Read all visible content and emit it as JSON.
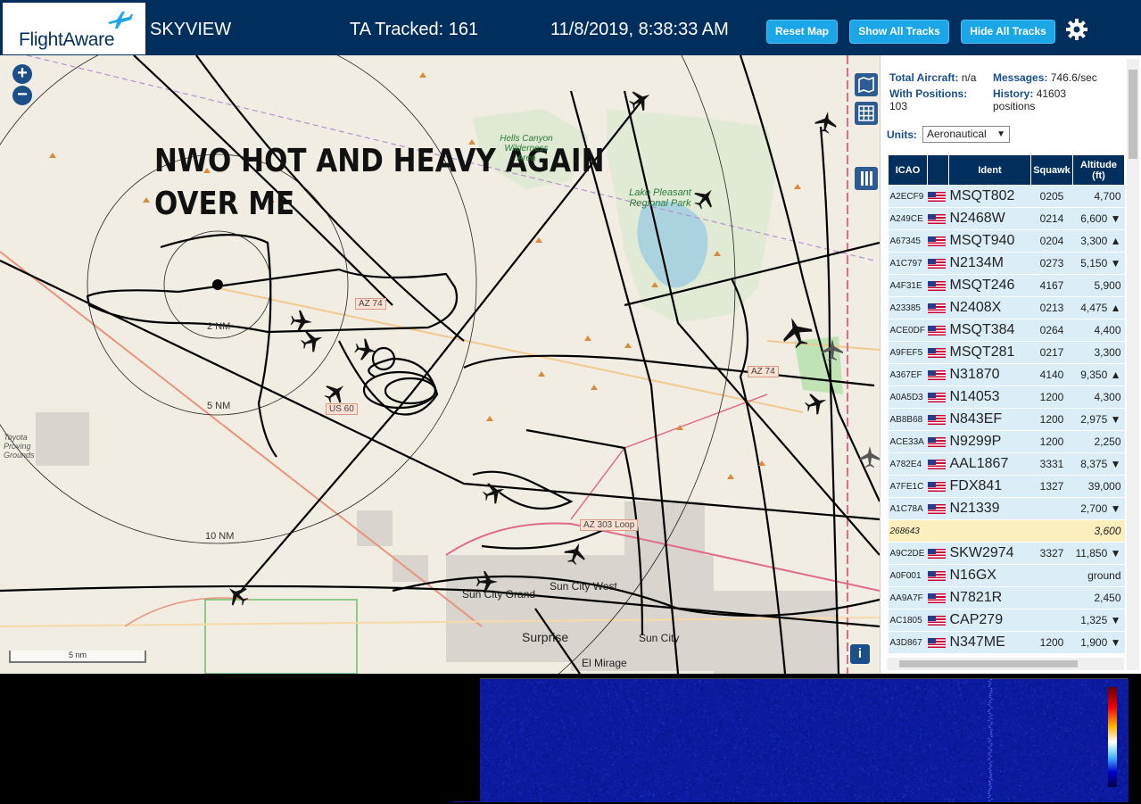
{
  "header": {
    "logo_text": "FlightAware",
    "app_title": "SKYVIEW",
    "tracked": "TA Tracked: 161",
    "datetime": "11/8/2019, 8:38:33 AM",
    "reset_map": "Reset Map",
    "show_all_tracks": "Show All Tracks",
    "hide_all_tracks": "Hide All Tracks",
    "settings_icon": "gear-icon",
    "brand_color": "#002f5d",
    "button_color": "#1ba6e8"
  },
  "map": {
    "annotation_line1": "NWO HOT AND HEAVY AGAIN",
    "annotation_line2": "OVER ME",
    "zoom_in": "+",
    "zoom_out": "−",
    "scale_label": "5 nm",
    "info_label": "i",
    "range_rings": {
      "r2": "2 NM",
      "r5": "5 NM",
      "r10": "10 NM"
    },
    "park1": "Hells Canyon Wilderness Area",
    "park2": "Lake Pleasant Regional Park",
    "place1": "Sun City Grand",
    "place2": "Sun City West",
    "place3": "Surprise",
    "place4": "Sun City",
    "place5": "El Mirage",
    "place6": "Toyota Proving Grounds",
    "road1": "AZ 74",
    "road2": "US 60",
    "road3": "AZ 303 Loop",
    "road4": "AZ 74"
  },
  "sidebar": {
    "total_aircraft_label": "Total Aircraft:",
    "total_aircraft_value": "n/a",
    "messages_label": "Messages:",
    "messages_value": "746.6/sec",
    "with_positions_label": "With Positions:",
    "with_positions_value": "103",
    "history_label": "History:",
    "history_value": "41603 positions",
    "units_label": "Units:",
    "units_value": "Aeronautical",
    "columns": [
      "ICAO",
      "",
      "Ident",
      "Squawk",
      "Altitude (ft)"
    ],
    "rows": [
      {
        "icao": "A2ECF9",
        "ident": "MSQT802",
        "squawk": "0205",
        "alt": "4,700"
      },
      {
        "icao": "A249CE",
        "ident": "N2468W",
        "squawk": "0214",
        "alt": "6,600 ▼"
      },
      {
        "icao": "A67345",
        "ident": "MSQT940",
        "squawk": "0204",
        "alt": "3,300 ▲"
      },
      {
        "icao": "A1C797",
        "ident": "N2134M",
        "squawk": "0273",
        "alt": "5,150 ▼"
      },
      {
        "icao": "A4F31E",
        "ident": "MSQT246",
        "squawk": "4167",
        "alt": "5,900"
      },
      {
        "icao": "A23385",
        "ident": "N2408X",
        "squawk": "0213",
        "alt": "4,475 ▲"
      },
      {
        "icao": "ACE0DF",
        "ident": "MSQT384",
        "squawk": "0264",
        "alt": "4,400"
      },
      {
        "icao": "A9FEF5",
        "ident": "MSQT281",
        "squawk": "0217",
        "alt": "3,300"
      },
      {
        "icao": "A367EF",
        "ident": "N31870",
        "squawk": "4140",
        "alt": "9,350 ▲"
      },
      {
        "icao": "A0A5D3",
        "ident": "N14053",
        "squawk": "1200",
        "alt": "4,300"
      },
      {
        "icao": "AB8B68",
        "ident": "N843EF",
        "squawk": "1200",
        "alt": "2,975 ▼"
      },
      {
        "icao": "ACE33A",
        "ident": "N9299P",
        "squawk": "1200",
        "alt": "2,250"
      },
      {
        "icao": "A782E4",
        "ident": "AAL1867",
        "squawk": "3331",
        "alt": "8,375 ▼"
      },
      {
        "icao": "A7FE1C",
        "ident": "FDX841",
        "squawk": "1327",
        "alt": "39,000"
      },
      {
        "icao": "A1C78A",
        "ident": "N21339",
        "squawk": "",
        "alt": "2,700 ▼"
      },
      {
        "icao": "268643",
        "ident": "",
        "squawk": "",
        "alt": "3,600",
        "highlight": true
      },
      {
        "icao": "A9C2DE",
        "ident": "SKW2974",
        "squawk": "3327",
        "alt": "11,850 ▼"
      },
      {
        "icao": "A0F001",
        "ident": "N16GX",
        "squawk": "",
        "alt": "ground"
      },
      {
        "icao": "AA9A7F",
        "ident": "N7821R",
        "squawk": "",
        "alt": "2,450"
      },
      {
        "icao": "AC1805",
        "ident": "CAP279",
        "squawk": "",
        "alt": "1,325 ▼"
      },
      {
        "icao": "A3D867",
        "ident": "N347ME",
        "squawk": "1200",
        "alt": "1,900 ▼"
      }
    ]
  }
}
